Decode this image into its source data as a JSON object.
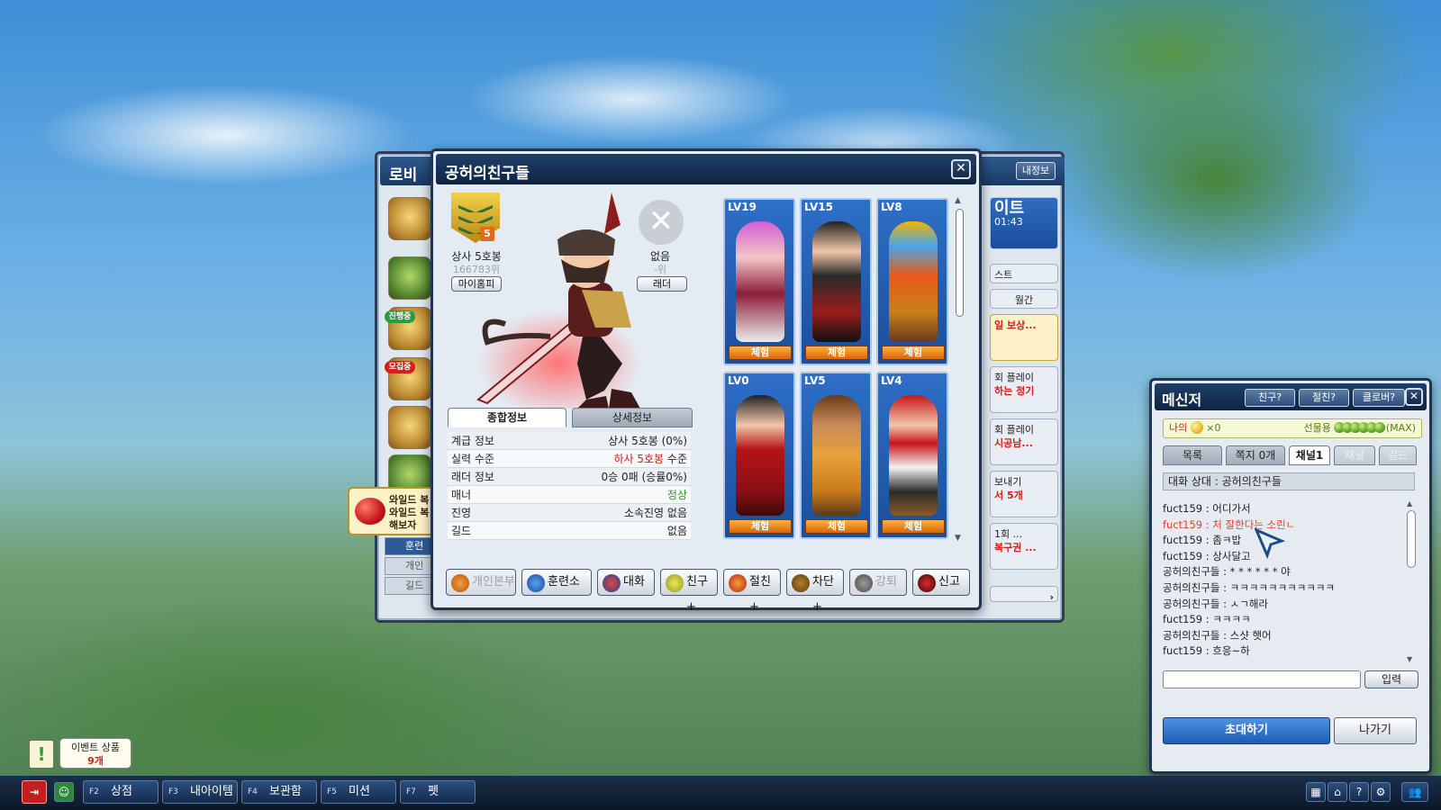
{
  "lobby": {
    "title": "로비",
    "my_info": "내정보",
    "side_badges": [
      "진행중",
      "모집중"
    ],
    "right_cards": {
      "header": "이트",
      "timer": "01:43",
      "quest": "스트",
      "monthly": "월간",
      "reward": "일 보상...",
      "play1_a": "회 플레이",
      "play1_b": "하는 정기",
      "play2_a": "회 플레이",
      "play2_b": "시공남...",
      "send_a": "보내기",
      "send_b": "서 5개",
      "once_a": "1회 ...",
      "once_b": "복구권 ..."
    },
    "bottom_list": [
      "훈련",
      "개인",
      "길드"
    ]
  },
  "wild_tip": {
    "line1": "와일드 복",
    "line2": "와일드 복",
    "line3": "해보자"
  },
  "profile": {
    "title": "공허의친구들",
    "rank_number": "5",
    "rank_name": "상사 5호봉",
    "rank_position": "166783위",
    "my_homepage_button": "마이홈피",
    "ladder_value": "없음",
    "ladder_position": "-위",
    "ladder_button": "래더",
    "tabs": {
      "summary": "종합정보",
      "detail": "상세정보"
    },
    "info_rows": [
      {
        "label": "계급 정보",
        "value": "상사 5호봉 (0%)",
        "color": "#222222"
      },
      {
        "label": "실력 수준",
        "value_red": "하사 5호봉",
        "value_rest": " 수준",
        "color": "#d3201a"
      },
      {
        "label": "래더 정보",
        "value": "0승 0패 (승률0%)",
        "color": "#222222"
      },
      {
        "label": "매너",
        "value": "정상",
        "color": "#2f9a22"
      },
      {
        "label": "진영",
        "value": "소속진영 없음",
        "color": "#222222"
      },
      {
        "label": "길드",
        "value": "없음",
        "color": "#222222"
      }
    ],
    "characters": [
      {
        "level": "LV19",
        "button": "체험"
      },
      {
        "level": "LV15",
        "button": "체험"
      },
      {
        "level": "LV8",
        "button": "체험"
      },
      {
        "level": "LV0",
        "button": "체험"
      },
      {
        "level": "LV5",
        "button": "체험"
      },
      {
        "level": "LV4",
        "button": "체험"
      }
    ],
    "actions": [
      {
        "label": "개인본부",
        "disabled": true,
        "icon": "home-icon"
      },
      {
        "label": "훈련소",
        "disabled": false,
        "icon": "training-icon"
      },
      {
        "label": "대화",
        "disabled": false,
        "icon": "chat-icon"
      },
      {
        "label": "친구+",
        "disabled": false,
        "icon": "friend-add-icon"
      },
      {
        "label": "절친+",
        "disabled": false,
        "icon": "best-friend-add-icon"
      },
      {
        "label": "차단+",
        "disabled": false,
        "icon": "block-icon"
      },
      {
        "label": "강퇴",
        "disabled": true,
        "icon": "kick-icon"
      },
      {
        "label": "신고",
        "disabled": false,
        "icon": "report-icon"
      }
    ]
  },
  "messenger": {
    "title": "메신저",
    "header_buttons": [
      "친구?",
      "절친?",
      "클로버?"
    ],
    "gift": {
      "mine_label": "나의",
      "mine_count": "×0",
      "gift_label": "선물용",
      "gift_max": "(MAX)"
    },
    "tabs": [
      "목록",
      "쪽지 0개",
      "채널1",
      "채널",
      "길드"
    ],
    "partner": "대화 상대 : 공허의친구들",
    "chat_lines": [
      {
        "text": "fuct159 : 어디가서",
        "highlight": false
      },
      {
        "text": "fuct159 : 처 잘한다는 소린ㄴ",
        "highlight": true
      },
      {
        "text": "fuct159 : 좀ㅋ밥",
        "highlight": false
      },
      {
        "text": "fuct159 : 상사달고",
        "highlight": false
      },
      {
        "text": "공허의친구들 : * * * * * * 야",
        "highlight": false
      },
      {
        "text": "공허의친구들 : ㅋㅋㅋㅋㅋㅋㅋㅋㅋㅋㅋ",
        "highlight": false
      },
      {
        "text": "공허의친구들 : ㅅㄱ해라",
        "highlight": false
      },
      {
        "text": "fuct159 : ㅋㅋㅋㅋ",
        "highlight": false
      },
      {
        "text": "공허의친구들 : 스샷 햇어",
        "highlight": false
      },
      {
        "text": "fuct159 : 흐응~하",
        "highlight": false
      }
    ],
    "input_value": "",
    "enter_button": "입력",
    "invite_button": "초대하기",
    "leave_button": "나가기"
  },
  "event": {
    "alert": "!",
    "label": "이벤트 상품",
    "count": "9개"
  },
  "taskbar": {
    "exit_icon": "exit-icon",
    "items": [
      {
        "key": "F2",
        "label": "상점"
      },
      {
        "key": "F3",
        "label": "내아이템"
      },
      {
        "key": "F4",
        "label": "보관함"
      },
      {
        "key": "F5",
        "label": "미션"
      },
      {
        "key": "F7",
        "label": "펫"
      }
    ]
  }
}
